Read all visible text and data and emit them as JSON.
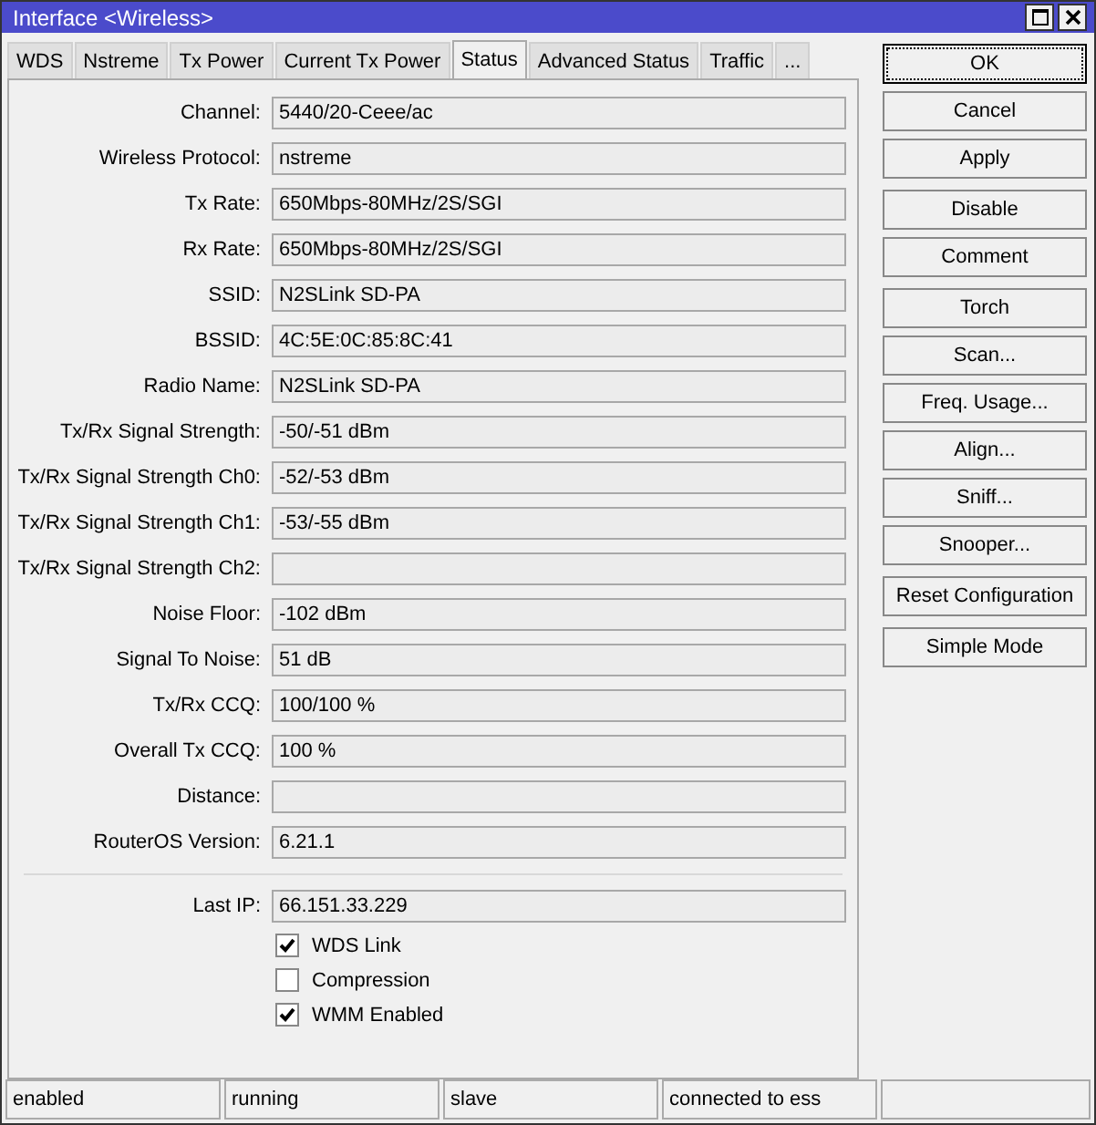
{
  "window": {
    "title": "Interface <Wireless>"
  },
  "tabs": [
    {
      "label": "WDS",
      "selected": false
    },
    {
      "label": "Nstreme",
      "selected": false
    },
    {
      "label": "Tx Power",
      "selected": false
    },
    {
      "label": "Current Tx Power",
      "selected": false
    },
    {
      "label": "Status",
      "selected": true
    },
    {
      "label": "Advanced Status",
      "selected": false
    },
    {
      "label": "Traffic",
      "selected": false
    },
    {
      "label": "...",
      "selected": false
    }
  ],
  "fields": [
    {
      "label": "Channel:",
      "value": "5440/20-Ceee/ac"
    },
    {
      "label": "Wireless Protocol:",
      "value": "nstreme"
    },
    {
      "label": "Tx Rate:",
      "value": "650Mbps-80MHz/2S/SGI"
    },
    {
      "label": "Rx Rate:",
      "value": "650Mbps-80MHz/2S/SGI"
    },
    {
      "label": "SSID:",
      "value": "N2SLink SD-PA"
    },
    {
      "label": "BSSID:",
      "value": "4C:5E:0C:85:8C:41"
    },
    {
      "label": "Radio Name:",
      "value": "N2SLink SD-PA"
    },
    {
      "label": "Tx/Rx Signal Strength:",
      "value": "-50/-51 dBm"
    },
    {
      "label": "Tx/Rx Signal Strength Ch0:",
      "value": "-52/-53 dBm"
    },
    {
      "label": "Tx/Rx Signal Strength Ch1:",
      "value": "-53/-55 dBm"
    },
    {
      "label": "Tx/Rx Signal Strength Ch2:"
    },
    {
      "label": "Noise Floor:",
      "value": "-102 dBm"
    },
    {
      "label": "Signal To Noise:",
      "value": "51 dB"
    },
    {
      "label": "Tx/Rx CCQ:",
      "value": "100/100 %"
    },
    {
      "label": "Overall Tx CCQ:",
      "value": "100 %"
    },
    {
      "label": "Distance:"
    },
    {
      "label": "RouterOS Version:",
      "value": "6.21.1"
    }
  ],
  "last_ip": {
    "label": "Last IP:",
    "value": "66.151.33.229"
  },
  "checkboxes": [
    {
      "label": "WDS Link",
      "checked": true
    },
    {
      "label": "Compression",
      "checked": false
    },
    {
      "label": "WMM Enabled",
      "checked": true
    }
  ],
  "button_groups": [
    [
      "OK",
      "Cancel",
      "Apply"
    ],
    [
      "Disable",
      "Comment"
    ],
    [
      "Torch",
      "Scan...",
      "Freq. Usage...",
      "Align...",
      "Sniff...",
      "Snooper..."
    ],
    [
      "Reset Configuration"
    ],
    [
      "Simple Mode"
    ]
  ],
  "status_bar": [
    "enabled",
    "running",
    "slave",
    "connected to ess"
  ]
}
